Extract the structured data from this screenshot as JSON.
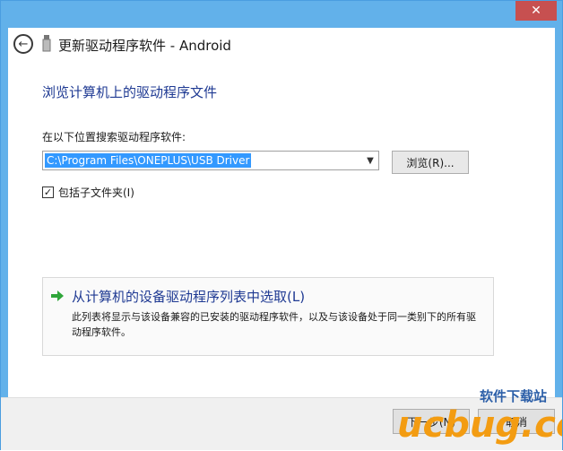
{
  "window": {
    "title": "更新驱动程序软件 - Android",
    "close_label": "✕"
  },
  "content": {
    "heading": "浏览计算机上的驱动程序文件",
    "search_label": "在以下位置搜索驱动程序软件:",
    "path_value": "C:\\Program Files\\ONEPLUS\\USB Driver",
    "browse_label": "浏览(R)...",
    "include_subfolders_label": "包括子文件夹(I)",
    "include_subfolders_checked": "✓",
    "pick_title": "从计算机的设备驱动程序列表中选取(L)",
    "pick_description": "此列表将显示与该设备兼容的已安装的驱动程序软件，以及与该设备处于同一类别下的所有驱动程序软件。"
  },
  "footer": {
    "next_label": "下一步(N)",
    "cancel_label": "取消"
  },
  "watermark": {
    "text": "ucbug.cc",
    "subtitle": "软件下载站"
  },
  "colors": {
    "frame": "#62b1ea",
    "heading": "#1f3a93",
    "selection": "#3399ff",
    "close": "#c75050"
  }
}
